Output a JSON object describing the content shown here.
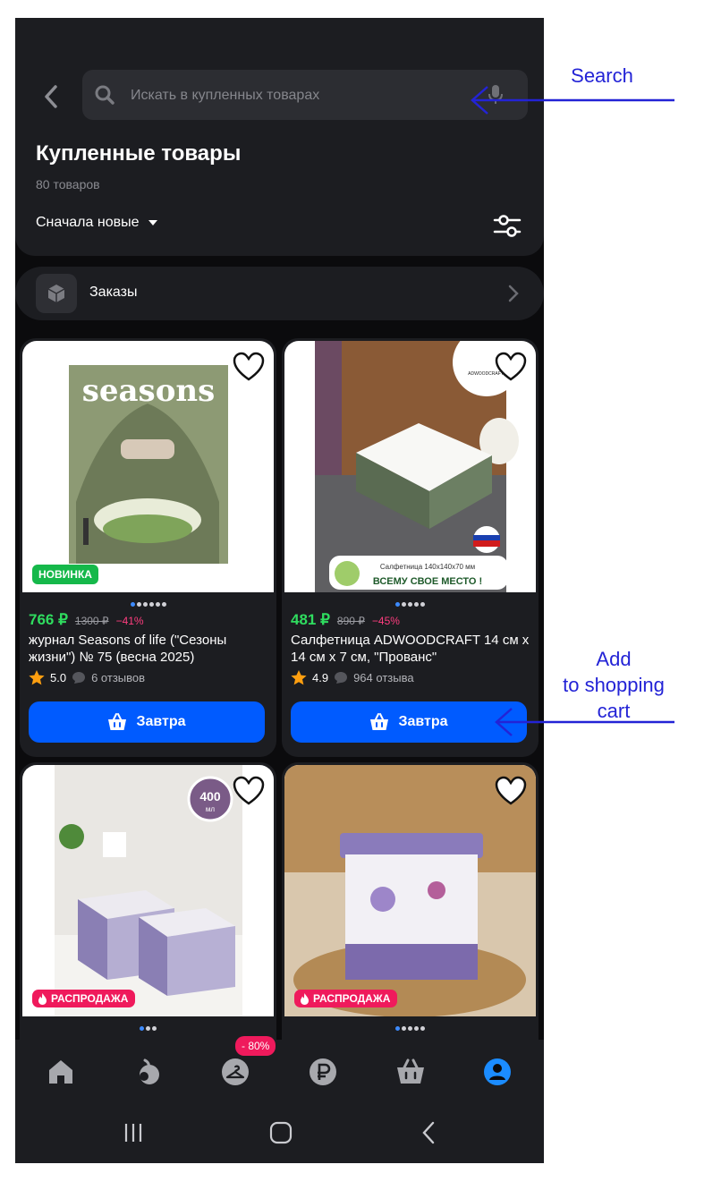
{
  "search": {
    "placeholder": "Искать в купленных товарах"
  },
  "header": {
    "title": "Купленные товары",
    "count": "80 товаров",
    "sort_label": "Сначала новые"
  },
  "orders": {
    "label": "Заказы"
  },
  "products": [
    {
      "price": "766 ₽",
      "old_price": "1300 ₽",
      "discount": "−41%",
      "title": "журнал Seasons of life (\"Сезоны жизни\") № 75 (весна 2025)",
      "rating": "5.0",
      "reviews": "6 отзывов",
      "badge": "НОВИНКА",
      "button": "Завтра",
      "cover_text": "seasons",
      "dots": 6,
      "active_dot": 0
    },
    {
      "price": "481 ₽",
      "old_price": "890 ₽",
      "discount": "−45%",
      "title": "Салфетница ADWOODCRAFT 14 см х 14 см х 7 см, \"Прованс\"",
      "rating": "4.9",
      "reviews": "964 отзыва",
      "button": "Завтра",
      "promo_line1": "Салфетница 140х140х70 мм",
      "promo_line2": "ВСЕМУ СВОЕ МЕСТО !",
      "brand": "ADWOODCRAFT",
      "dots": 5,
      "active_dot": 0
    },
    {
      "badge": "РАСПРОДАЖА",
      "volume": "400",
      "volume_unit": "мл",
      "dots": 3,
      "active_dot": 0
    },
    {
      "badge": "РАСПРОДАЖА",
      "dots": 5,
      "active_dot": 0
    }
  ],
  "bottom_nav": {
    "items": [
      "home-icon",
      "apple-icon",
      "hanger-icon",
      "ruble-icon",
      "basket-icon",
      "profile-icon"
    ],
    "promo_badge": "- 80%"
  },
  "annotations": {
    "search": "Search",
    "cart_line1": "Add",
    "cart_line2": "to shopping",
    "cart_line3": "cart"
  },
  "colors": {
    "accent": "#005bff",
    "price": "#2fdc5f",
    "discount": "#ff3d7f",
    "sale": "#ef1a5c",
    "new": "#15b84a",
    "annotation": "#2323d6"
  }
}
